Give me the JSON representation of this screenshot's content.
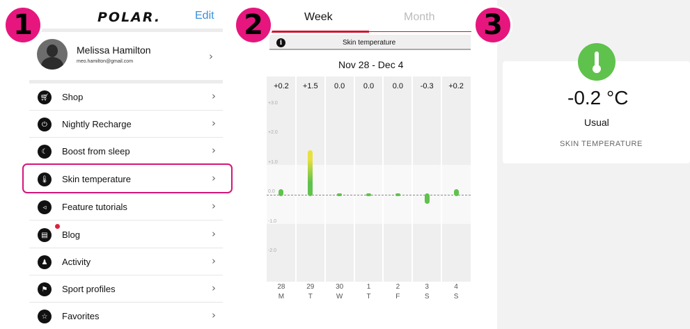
{
  "badges": [
    "1",
    "2",
    "3"
  ],
  "header": {
    "logo": "POLAR.",
    "edit": "Edit"
  },
  "profile": {
    "name": "Melissa Hamilton",
    "email": "meo.hamilton@gmail.com"
  },
  "menu": [
    {
      "label": "Shop",
      "icon": "cart-icon"
    },
    {
      "label": "Nightly Recharge",
      "icon": "power-icon"
    },
    {
      "label": "Boost from sleep",
      "icon": "moon-icon"
    },
    {
      "label": "Skin temperature",
      "icon": "thermometer-icon"
    },
    {
      "label": "Feature tutorials",
      "icon": "whistle-icon"
    },
    {
      "label": "Blog",
      "icon": "blog-icon"
    },
    {
      "label": "Activity",
      "icon": "activity-icon"
    },
    {
      "label": "Sport profiles",
      "icon": "runner-icon"
    },
    {
      "label": "Favorites",
      "icon": "star-icon"
    }
  ],
  "tabs": {
    "week": "Week",
    "month": "Month"
  },
  "info_bar": {
    "label": "Skin temperature"
  },
  "date_range": "Nov 28 - Dec 4",
  "chart_data": {
    "type": "bar",
    "categories": [
      "28 M",
      "29 T",
      "30 W",
      "1 T",
      "2 F",
      "3 S",
      "4 S"
    ],
    "days": [
      "28",
      "29",
      "30",
      "1",
      "2",
      "3",
      "4"
    ],
    "weekdays": [
      "M",
      "T",
      "W",
      "T",
      "F",
      "S",
      "S"
    ],
    "value_labels": [
      "+0.2",
      "+1.5",
      "0.0",
      "0.0",
      "0.0",
      "-0.3",
      "+0.2"
    ],
    "values": [
      0.2,
      1.5,
      0.0,
      0.0,
      0.0,
      -0.3,
      0.2
    ],
    "y_ticks": [
      "+3.0",
      "+2.0",
      "+1.0",
      "0.0",
      "-1.0",
      "-2.0"
    ],
    "ylim": [
      -2.5,
      3.2
    ],
    "usual_band": [
      -1.0,
      1.0
    ],
    "colors": {
      "normal": "#5fc24c",
      "elevated": "#e8e040"
    }
  },
  "detail": {
    "value": "-0.2 °C",
    "status": "Usual",
    "caption": "SKIN TEMPERATURE",
    "accent": "#5fc24c"
  }
}
